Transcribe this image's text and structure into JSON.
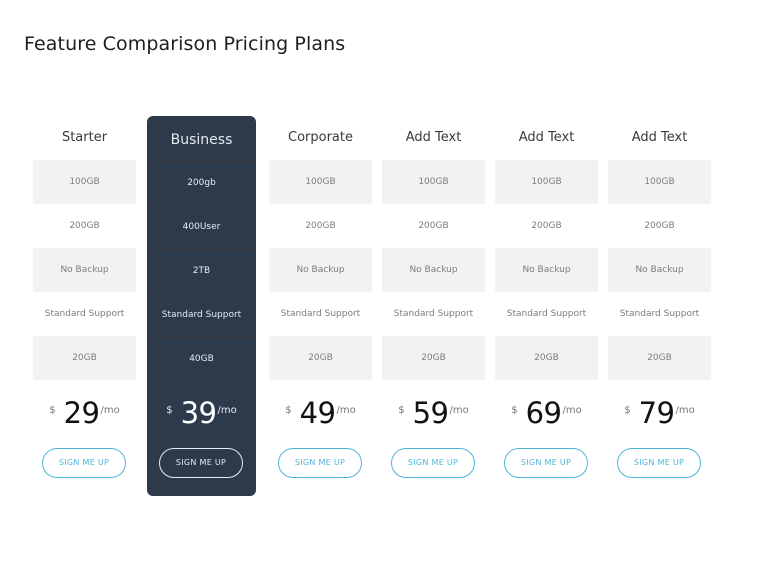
{
  "page": {
    "title": "Feature Comparison Pricing Plans"
  },
  "colors": {
    "featured_background": "#2c3a4c",
    "button_accent": "#4fb6d8",
    "shaded_cell": "#f2f2f2"
  },
  "plans": [
    {
      "name": "Starter",
      "featured": false,
      "features": [
        "100GB",
        "200GB",
        "No Backup",
        "Standard Support",
        "20GB"
      ],
      "currency": "$",
      "price": "29",
      "period": "/mo",
      "button_label": "SIGN ME UP"
    },
    {
      "name": "Business",
      "featured": true,
      "features": [
        "200gb",
        "400User",
        "2TB",
        "Standard Support",
        "40GB"
      ],
      "currency": "$",
      "price": "39",
      "period": "/mo",
      "button_label": "SIGN ME UP"
    },
    {
      "name": "Corporate",
      "featured": false,
      "features": [
        "100GB",
        "200GB",
        "No Backup",
        "Standard Support",
        "20GB"
      ],
      "currency": "$",
      "price": "49",
      "period": "/mo",
      "button_label": "SIGN ME UP"
    },
    {
      "name": "Add Text",
      "featured": false,
      "features": [
        "100GB",
        "200GB",
        "No Backup",
        "Standard Support",
        "20GB"
      ],
      "currency": "$",
      "price": "59",
      "period": "/mo",
      "button_label": "SIGN ME UP"
    },
    {
      "name": "Add Text",
      "featured": false,
      "features": [
        "100GB",
        "200GB",
        "No Backup",
        "Standard Support",
        "20GB"
      ],
      "currency": "$",
      "price": "69",
      "period": "/mo",
      "button_label": "SIGN ME UP"
    },
    {
      "name": "Add Text",
      "featured": false,
      "features": [
        "100GB",
        "200GB",
        "No Backup",
        "Standard Support",
        "20GB"
      ],
      "currency": "$",
      "price": "79",
      "period": "/mo",
      "button_label": "SIGN ME UP"
    }
  ]
}
